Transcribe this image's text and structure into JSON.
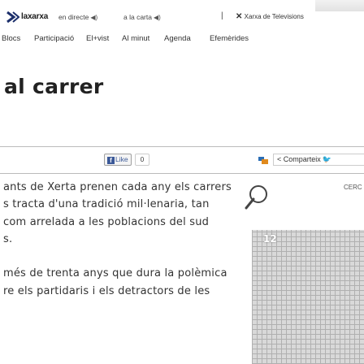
{
  "topbar": {
    "brand": "laxarxa",
    "links": [
      "en directe",
      "a la carta"
    ],
    "separator": "|",
    "tv_label": "Xarxa de Televisions",
    "tv_symbol": "✕"
  },
  "nav": {
    "items": [
      "Blocs",
      "Participació",
      "El+vist",
      "Al minut",
      "Agenda",
      "Efemèrides"
    ]
  },
  "article": {
    "title": "al carrer",
    "paragraph_lines": [
      "ants de Xerta prenen cada any els carrers",
      "s tracta d'una tradició mil·lenaria, tan",
      " com arrelada a les poblacions del sud",
      "s.",
      "",
      "més de trenta anys que dura la polèmica",
      "re els partidaris i els detractors de les"
    ]
  },
  "social": {
    "like_label": "Like",
    "like_count": "0",
    "share_label": "Comparteix"
  },
  "media": {
    "cerc_label": "CERC",
    "poster_number": "12"
  },
  "colors": {
    "facebook": "#3b5998",
    "twitter": "#1da1f2",
    "logo": "#1c2f6b"
  }
}
